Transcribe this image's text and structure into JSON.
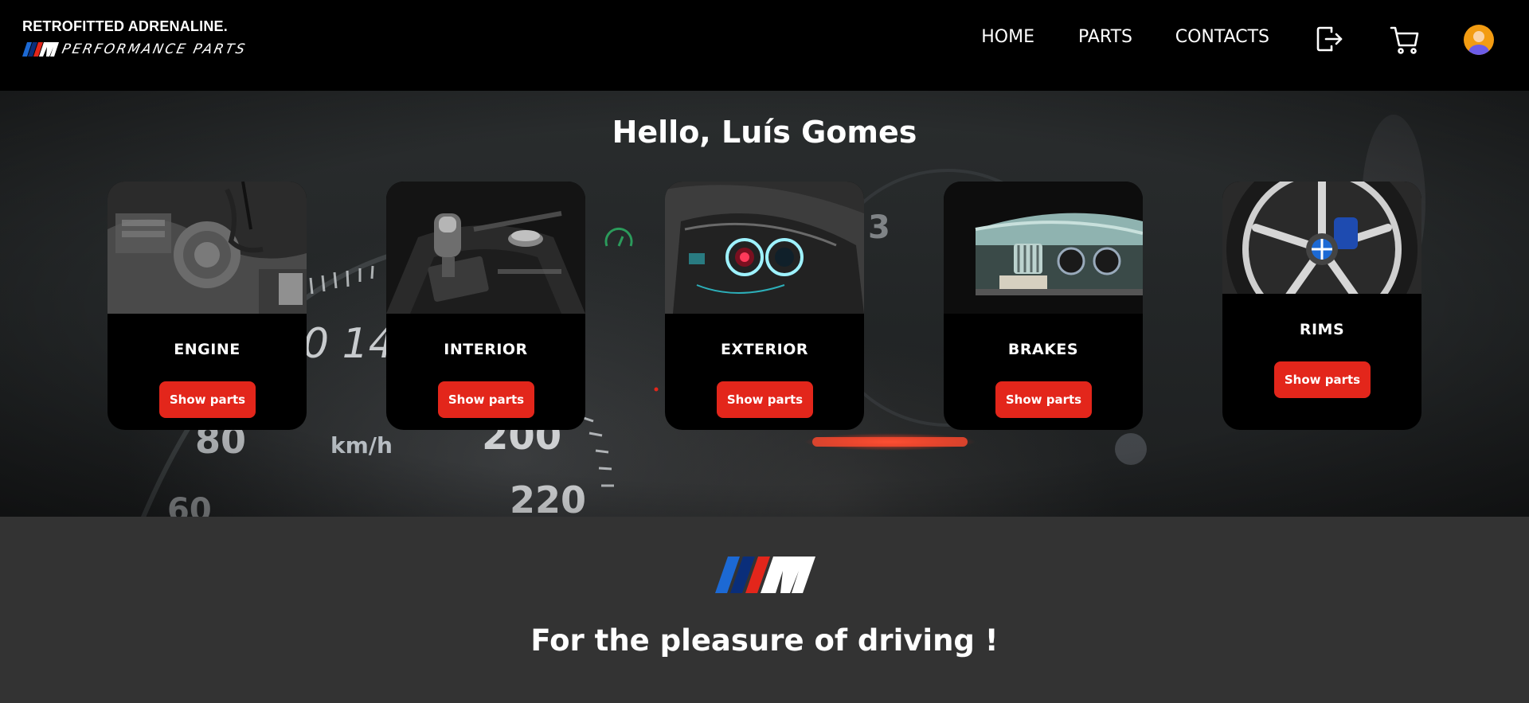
{
  "brand": {
    "tagline": "RETROFITTED ADRENALINE.",
    "subtitle": "PERFORMANCE PARTS",
    "logo_icon": "m-stripes-logo"
  },
  "nav": {
    "home": "HOME",
    "parts": "PARTS",
    "contacts": "CONTACTS",
    "logout_icon": "logout-icon",
    "cart_icon": "cart-icon",
    "avatar_icon": "user-avatar-icon"
  },
  "hero": {
    "greeting": "Hello, Luís Gomes"
  },
  "categories": [
    {
      "label": "ENGINE",
      "button": "Show parts",
      "image": "engine-photo"
    },
    {
      "label": "INTERIOR",
      "button": "Show parts",
      "image": "interior-photo"
    },
    {
      "label": "EXTERIOR",
      "button": "Show parts",
      "image": "exterior-photo"
    },
    {
      "label": "BRAKES",
      "button": "Show parts",
      "image": "brakes-photo"
    },
    {
      "label": "RIMS",
      "button": "Show parts",
      "image": "rims-photo"
    }
  ],
  "footer": {
    "slogan": "For the pleasure of driving !",
    "logo_icon": "m-stripes-logo"
  },
  "colors": {
    "accent_red": "#e3261b",
    "header_bg": "#000000",
    "footer_bg": "#333333",
    "m_blue_light": "#1c69d4",
    "m_blue_dark": "#0a2e7a",
    "m_red": "#e3261b"
  },
  "speedometer_labels": [
    "140",
    "80",
    "km/h",
    "200",
    "220",
    "60"
  ]
}
